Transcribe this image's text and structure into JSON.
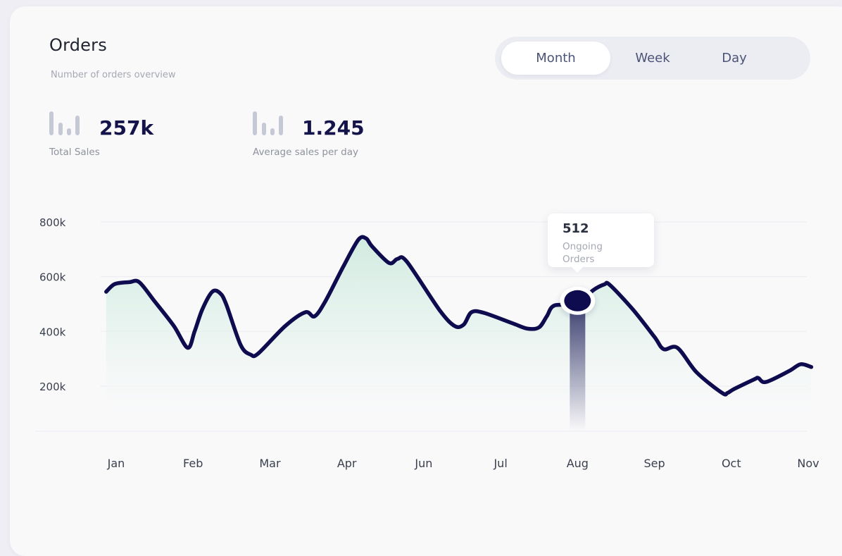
{
  "header": {
    "title": "Orders",
    "subtitle": "Number of orders overview"
  },
  "toggle": {
    "options": [
      "Month",
      "Week",
      "Day"
    ],
    "selected": "Month"
  },
  "stats": [
    {
      "value": "257k",
      "label": "Total Sales",
      "icon": "bar-chart-icon"
    },
    {
      "value": "1.245",
      "label": "Average sales per day",
      "icon": "bar-chart-icon"
    }
  ],
  "tooltip": {
    "value": "512",
    "label": "Ongoing Orders"
  },
  "colors": {
    "line": "#0e0c4e",
    "area_top": "#cfeadf",
    "marker": "#0e0c4e",
    "grid": "#ececf1"
  },
  "chart_data": {
    "type": "area",
    "x_tick_labels": [
      "Jan",
      "Feb",
      "Mar",
      "Apr",
      "Jun",
      "Jul",
      "Aug",
      "Sep",
      "Oct",
      "Nov"
    ],
    "y_tick_labels": [
      "800k",
      "600k",
      "400k",
      "200k"
    ],
    "y_ticks": [
      800000,
      600000,
      400000,
      200000
    ],
    "ylim": [
      35000,
      800000
    ],
    "xlim": [
      0,
      9
    ],
    "grid": true,
    "series": [
      {
        "x": [
          -0.13,
          -0.06,
          0.0,
          0.17,
          0.3,
          0.5,
          0.75,
          0.93,
          1.02,
          1.12,
          1.25,
          1.35,
          1.43,
          1.62,
          1.75,
          1.85,
          2.2,
          2.46,
          2.58,
          2.72,
          2.95,
          3.15,
          3.25,
          3.33,
          3.55,
          3.66,
          3.78,
          4.2,
          4.4,
          4.52,
          4.62,
          4.78,
          5.15,
          5.35,
          5.5,
          5.6,
          5.7,
          6.0,
          6.2,
          6.35,
          6.42,
          6.72,
          7.0,
          7.12,
          7.3,
          7.55,
          7.88,
          7.95,
          8.04,
          8.3,
          8.35,
          8.45,
          8.75,
          8.9,
          9.04
        ],
        "y": [
          545000,
          565000,
          575000,
          580000,
          580000,
          510000,
          420000,
          340000,
          400000,
          480000,
          545000,
          540000,
          500000,
          350000,
          315000,
          320000,
          420000,
          470000,
          455000,
          510000,
          635000,
          735000,
          740000,
          710000,
          650000,
          665000,
          655000,
          480000,
          420000,
          425000,
          470000,
          468000,
          430000,
          410000,
          415000,
          455000,
          495000,
          500000,
          550000,
          572000,
          570000,
          480000,
          380000,
          335000,
          340000,
          250000,
          175000,
          175000,
          190000,
          225000,
          230000,
          215000,
          255000,
          280000,
          270000
        ]
      }
    ],
    "highlight": {
      "x": 6.0,
      "y": 512000
    }
  }
}
